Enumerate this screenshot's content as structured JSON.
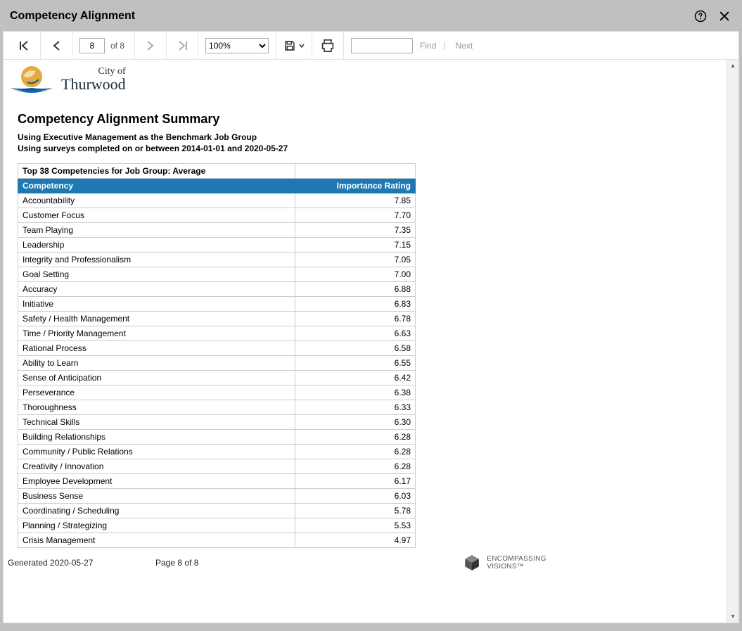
{
  "window_title": "Competency Alignment",
  "toolbar": {
    "page_current": "8",
    "of_label": "of",
    "page_total": "8",
    "zoom_value": "100%",
    "find_label": "Find",
    "next_label": "Next",
    "search_value": ""
  },
  "logo": {
    "line1": "City of",
    "line2": "Thurwood"
  },
  "report": {
    "title": "Competency Alignment Summary",
    "sub1": "Using Executive Management as the Benchmark Job Group",
    "sub2": "Using surveys completed on or between 2014-01-01 and 2020-05-27",
    "table_caption": "Top 38 Competencies for Job Group: Average",
    "col_competency": "Competency",
    "col_rating": "Importance Rating",
    "rows": [
      {
        "name": "Accountability",
        "rating": "7.85"
      },
      {
        "name": "Customer Focus",
        "rating": "7.70"
      },
      {
        "name": "Team Playing",
        "rating": "7.35"
      },
      {
        "name": "Leadership",
        "rating": "7.15"
      },
      {
        "name": "Integrity and Professionalism",
        "rating": "7.05"
      },
      {
        "name": "Goal Setting",
        "rating": "7.00"
      },
      {
        "name": "Accuracy",
        "rating": "6.88"
      },
      {
        "name": "Initiative",
        "rating": "6.83"
      },
      {
        "name": "Safety / Health Management",
        "rating": "6.78"
      },
      {
        "name": "Time / Priority Management",
        "rating": "6.63"
      },
      {
        "name": "Rational Process",
        "rating": "6.58"
      },
      {
        "name": "Ability to Learn",
        "rating": "6.55"
      },
      {
        "name": "Sense of Anticipation",
        "rating": "6.42"
      },
      {
        "name": "Perseverance",
        "rating": "6.38"
      },
      {
        "name": "Thoroughness",
        "rating": "6.33"
      },
      {
        "name": "Technical Skills",
        "rating": "6.30"
      },
      {
        "name": "Building Relationships",
        "rating": "6.28"
      },
      {
        "name": "Community / Public Relations",
        "rating": "6.28"
      },
      {
        "name": "Creativity / Innovation",
        "rating": "6.28"
      },
      {
        "name": "Employee Development",
        "rating": "6.17"
      },
      {
        "name": "Business Sense",
        "rating": "6.03"
      },
      {
        "name": "Coordinating / Scheduling",
        "rating": "5.78"
      },
      {
        "name": "Planning / Strategizing",
        "rating": "5.53"
      },
      {
        "name": "Crisis Management",
        "rating": "4.97"
      }
    ]
  },
  "footer": {
    "generated": "Generated 2020-05-27",
    "page": "Page 8 of 8",
    "brand_line1": "ENCOMPASSING",
    "brand_line2": "VISIONS™"
  }
}
